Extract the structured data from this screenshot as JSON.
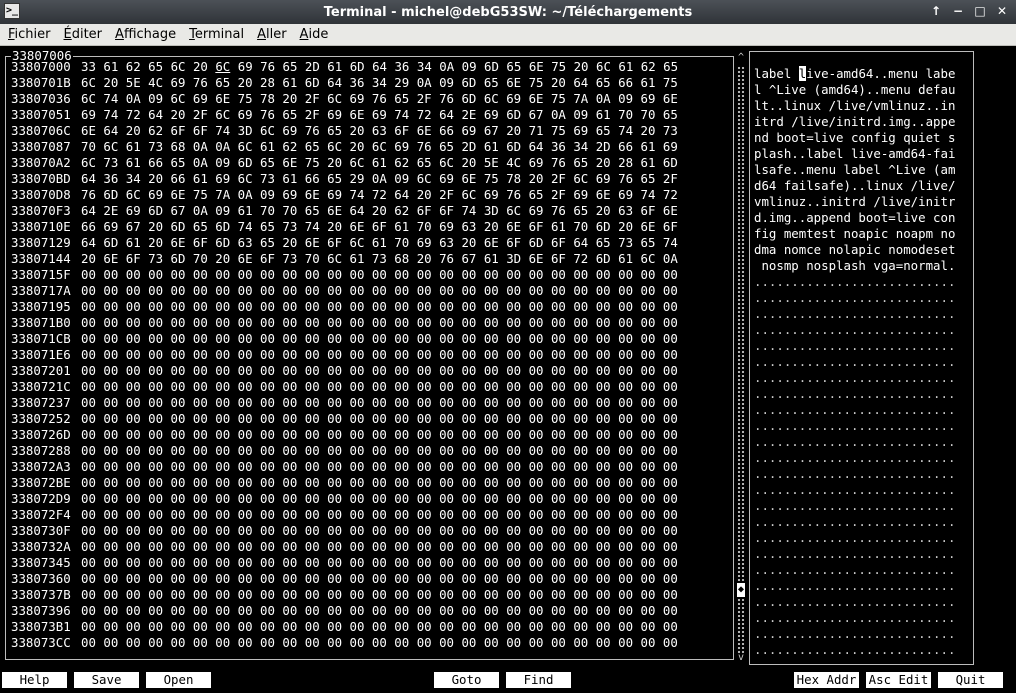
{
  "window": {
    "title": "Terminal - michel@debG53SW: ~/Téléchargements",
    "controls": {
      "up": "↑",
      "minimize": "−",
      "maximize": "□",
      "close": "✕"
    }
  },
  "menu": [
    {
      "u": "F",
      "rest": "ichier"
    },
    {
      "u": "É",
      "rest": "diter"
    },
    {
      "u": "A",
      "rest": "ffichage"
    },
    {
      "u": "T",
      "rest": "erminal"
    },
    {
      "u": "A",
      "rest": "ller"
    },
    {
      "u": "A",
      "rest": "ide"
    }
  ],
  "hex": {
    "top_address": "33807006",
    "rows": [
      {
        "addr": "33807000",
        "bytes": "33 61 62 65 6C 20 6C 69 76 65 2D 61 6D 64 36 34 0A 09 6D 65 6E 75 20 6C 61 62 65"
      },
      {
        "addr": "3380701B",
        "bytes": "6C 20 5E 4C 69 76 65 20 28 61 6D 64 36 34 29 0A 09 6D 65 6E 75 20 64 65 66 61 75"
      },
      {
        "addr": "33807036",
        "bytes": "6C 74 0A 09 6C 69 6E 75 78 20 2F 6C 69 76 65 2F 76 6D 6C 69 6E 75 7A 0A 09 69 6E"
      },
      {
        "addr": "33807051",
        "bytes": "69 74 72 64 20 2F 6C 69 76 65 2F 69 6E 69 74 72 64 2E 69 6D 67 0A 09 61 70 70 65"
      },
      {
        "addr": "3380706C",
        "bytes": "6E 64 20 62 6F 6F 74 3D 6C 69 76 65 20 63 6F 6E 66 69 67 20 71 75 69 65 74 20 73"
      },
      {
        "addr": "33807087",
        "bytes": "70 6C 61 73 68 0A 0A 6C 61 62 65 6C 20 6C 69 76 65 2D 61 6D 64 36 34 2D 66 61 69"
      },
      {
        "addr": "338070A2",
        "bytes": "6C 73 61 66 65 0A 09 6D 65 6E 75 20 6C 61 62 65 6C 20 5E 4C 69 76 65 20 28 61 6D"
      },
      {
        "addr": "338070BD",
        "bytes": "64 36 34 20 66 61 69 6C 73 61 66 65 29 0A 09 6C 69 6E 75 78 20 2F 6C 69 76 65 2F"
      },
      {
        "addr": "338070D8",
        "bytes": "76 6D 6C 69 6E 75 7A 0A 09 69 6E 69 74 72 64 20 2F 6C 69 76 65 2F 69 6E 69 74 72"
      },
      {
        "addr": "338070F3",
        "bytes": "64 2E 69 6D 67 0A 09 61 70 70 65 6E 64 20 62 6F 6F 74 3D 6C 69 76 65 20 63 6F 6E"
      },
      {
        "addr": "3380710E",
        "bytes": "66 69 67 20 6D 65 6D 74 65 73 74 20 6E 6F 61 70 69 63 20 6E 6F 61 70 6D 20 6E 6F"
      },
      {
        "addr": "33807129",
        "bytes": "64 6D 61 20 6E 6F 6D 63 65 20 6E 6F 6C 61 70 69 63 20 6E 6F 6D 6F 64 65 73 65 74"
      },
      {
        "addr": "33807144",
        "bytes": "20 6E 6F 73 6D 70 20 6E 6F 73 70 6C 61 73 68 20 76 67 61 3D 6E 6F 72 6D 61 6C 0A"
      },
      {
        "addr": "3380715F",
        "bytes": "00 00 00 00 00 00 00 00 00 00 00 00 00 00 00 00 00 00 00 00 00 00 00 00 00 00 00"
      },
      {
        "addr": "3380717A",
        "bytes": "00 00 00 00 00 00 00 00 00 00 00 00 00 00 00 00 00 00 00 00 00 00 00 00 00 00 00"
      },
      {
        "addr": "33807195",
        "bytes": "00 00 00 00 00 00 00 00 00 00 00 00 00 00 00 00 00 00 00 00 00 00 00 00 00 00 00"
      },
      {
        "addr": "338071B0",
        "bytes": "00 00 00 00 00 00 00 00 00 00 00 00 00 00 00 00 00 00 00 00 00 00 00 00 00 00 00"
      },
      {
        "addr": "338071CB",
        "bytes": "00 00 00 00 00 00 00 00 00 00 00 00 00 00 00 00 00 00 00 00 00 00 00 00 00 00 00"
      },
      {
        "addr": "338071E6",
        "bytes": "00 00 00 00 00 00 00 00 00 00 00 00 00 00 00 00 00 00 00 00 00 00 00 00 00 00 00"
      },
      {
        "addr": "33807201",
        "bytes": "00 00 00 00 00 00 00 00 00 00 00 00 00 00 00 00 00 00 00 00 00 00 00 00 00 00 00"
      },
      {
        "addr": "3380721C",
        "bytes": "00 00 00 00 00 00 00 00 00 00 00 00 00 00 00 00 00 00 00 00 00 00 00 00 00 00 00"
      },
      {
        "addr": "33807237",
        "bytes": "00 00 00 00 00 00 00 00 00 00 00 00 00 00 00 00 00 00 00 00 00 00 00 00 00 00 00"
      },
      {
        "addr": "33807252",
        "bytes": "00 00 00 00 00 00 00 00 00 00 00 00 00 00 00 00 00 00 00 00 00 00 00 00 00 00 00"
      },
      {
        "addr": "3380726D",
        "bytes": "00 00 00 00 00 00 00 00 00 00 00 00 00 00 00 00 00 00 00 00 00 00 00 00 00 00 00"
      },
      {
        "addr": "33807288",
        "bytes": "00 00 00 00 00 00 00 00 00 00 00 00 00 00 00 00 00 00 00 00 00 00 00 00 00 00 00"
      },
      {
        "addr": "338072A3",
        "bytes": "00 00 00 00 00 00 00 00 00 00 00 00 00 00 00 00 00 00 00 00 00 00 00 00 00 00 00"
      },
      {
        "addr": "338072BE",
        "bytes": "00 00 00 00 00 00 00 00 00 00 00 00 00 00 00 00 00 00 00 00 00 00 00 00 00 00 00"
      },
      {
        "addr": "338072D9",
        "bytes": "00 00 00 00 00 00 00 00 00 00 00 00 00 00 00 00 00 00 00 00 00 00 00 00 00 00 00"
      },
      {
        "addr": "338072F4",
        "bytes": "00 00 00 00 00 00 00 00 00 00 00 00 00 00 00 00 00 00 00 00 00 00 00 00 00 00 00"
      },
      {
        "addr": "3380730F",
        "bytes": "00 00 00 00 00 00 00 00 00 00 00 00 00 00 00 00 00 00 00 00 00 00 00 00 00 00 00"
      },
      {
        "addr": "3380732A",
        "bytes": "00 00 00 00 00 00 00 00 00 00 00 00 00 00 00 00 00 00 00 00 00 00 00 00 00 00 00"
      },
      {
        "addr": "33807345",
        "bytes": "00 00 00 00 00 00 00 00 00 00 00 00 00 00 00 00 00 00 00 00 00 00 00 00 00 00 00"
      },
      {
        "addr": "33807360",
        "bytes": "00 00 00 00 00 00 00 00 00 00 00 00 00 00 00 00 00 00 00 00 00 00 00 00 00 00 00"
      },
      {
        "addr": "3380737B",
        "bytes": "00 00 00 00 00 00 00 00 00 00 00 00 00 00 00 00 00 00 00 00 00 00 00 00 00 00 00"
      },
      {
        "addr": "33807396",
        "bytes": "00 00 00 00 00 00 00 00 00 00 00 00 00 00 00 00 00 00 00 00 00 00 00 00 00 00 00"
      },
      {
        "addr": "338073B1",
        "bytes": "00 00 00 00 00 00 00 00 00 00 00 00 00 00 00 00 00 00 00 00 00 00 00 00 00 00 00"
      },
      {
        "addr": "338073CC",
        "bytes": "00 00 00 00 00 00 00 00 00 00 00 00 00 00 00 00 00 00 00 00 00 00 00 00 00 00 00"
      }
    ]
  },
  "scrollbar": {
    "up": "^",
    "down": "v",
    "thumb": "◆",
    "position": 0.9
  },
  "ascii": {
    "lines": [
      "label live-amd64..menu labe",
      "l ^Live (amd64)..menu defau",
      "lt..linux /live/vmlinuz..in",
      "itrd /live/initrd.img..appe",
      "nd boot=live config quiet s",
      "plash..label live-amd64-fai",
      "lsafe..menu label ^Live (am",
      "d64 failsafe)..linux /live/",
      "vmlinuz..initrd /live/initr",
      "d.img..append boot=live con",
      "fig memtest noapic noapm no",
      "dma nomce nolapic nomodeset",
      " nosmp nosplash vga=normal."
    ],
    "dots": "...........................",
    "dot_rows": 24
  },
  "footer": {
    "help": "Help",
    "save": "Save",
    "open": "Open",
    "goto": "Goto",
    "find": "Find",
    "hex_addr": "Hex Addr",
    "asc_edit": "Asc Edit",
    "quit": "Quit"
  }
}
